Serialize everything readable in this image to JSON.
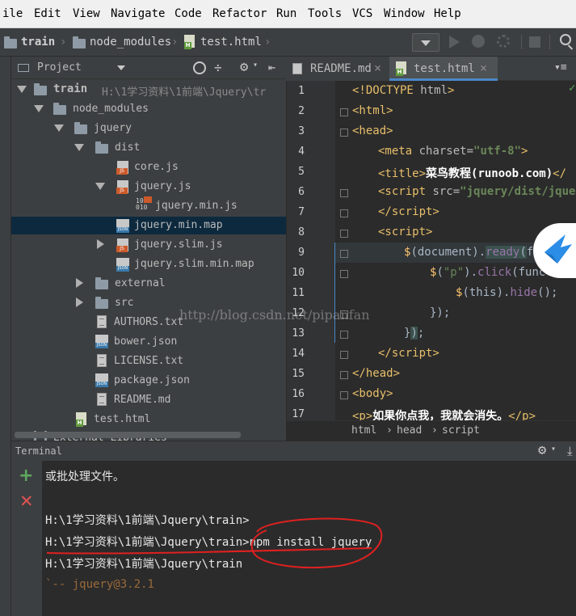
{
  "menu": [
    "ile",
    "Edit",
    "View",
    "Navigate",
    "Code",
    "Refactor",
    "Run",
    "Tools",
    "VCS",
    "Window",
    "Help"
  ],
  "breadcrumb": [
    "train",
    "node_modules",
    "test.html"
  ],
  "project_panel": {
    "title": "Project",
    "tree": [
      {
        "label": "train",
        "extra": "H:\\1学习资料\\1前端\\Jquery\\tr",
        "type": "folder",
        "expanded": true
      },
      {
        "label": "node_modules",
        "type": "folder",
        "expanded": true
      },
      {
        "label": "jquery",
        "type": "folder",
        "expanded": true
      },
      {
        "label": "dist",
        "type": "folder",
        "expanded": true
      },
      {
        "label": "core.js",
        "type": "js"
      },
      {
        "label": "jquery.js",
        "type": "js",
        "expanded": true
      },
      {
        "label": "jquery.min.js",
        "type": "js-min"
      },
      {
        "label": "jquery.min.map",
        "type": "json",
        "selected": true
      },
      {
        "label": "jquery.slim.js",
        "type": "js",
        "expanded": false
      },
      {
        "label": "jquery.slim.min.map",
        "type": "json"
      },
      {
        "label": "external",
        "type": "folder",
        "expanded": false
      },
      {
        "label": "src",
        "type": "folder",
        "expanded": false
      },
      {
        "label": "AUTHORS.txt",
        "type": "txt"
      },
      {
        "label": "bower.json",
        "type": "json"
      },
      {
        "label": "LICENSE.txt",
        "type": "txt"
      },
      {
        "label": "package.json",
        "type": "json"
      },
      {
        "label": "README.md",
        "type": "txt"
      },
      {
        "label": "test.html",
        "type": "html"
      },
      {
        "label": "External Libraries",
        "type": "lib"
      }
    ]
  },
  "editor": {
    "tabs": [
      {
        "label": "README.md",
        "active": false
      },
      {
        "label": "test.html",
        "active": true
      }
    ],
    "line_numbers": [
      "1",
      "2",
      "3",
      "4",
      "5",
      "6",
      "7",
      "8",
      "9",
      "10",
      "11",
      "12",
      "13",
      "14",
      "15",
      "16",
      "17"
    ],
    "breadcrumb": [
      "html",
      "head",
      "script"
    ]
  },
  "terminal": {
    "title": "Terminal",
    "lines": [
      "或批处理文件。",
      "",
      "H:\\1学习资料\\1前端\\Jquery\\train>",
      "H:\\1学习资料\\1前端\\Jquery\\train>npm install jquery",
      "H:\\1学习资料\\1前端\\Jquery\\train",
      "`-- jquery@3.2.1"
    ]
  },
  "watermark": "http://blog.csdn.net/pipanfan",
  "colors": {
    "background": "#3c3f41",
    "editor_bg": "#2b2b2b",
    "tag": "#e8bf6a",
    "string": "#6a8759",
    "selection": "#0d293e",
    "annotation_red": "#e02020"
  }
}
